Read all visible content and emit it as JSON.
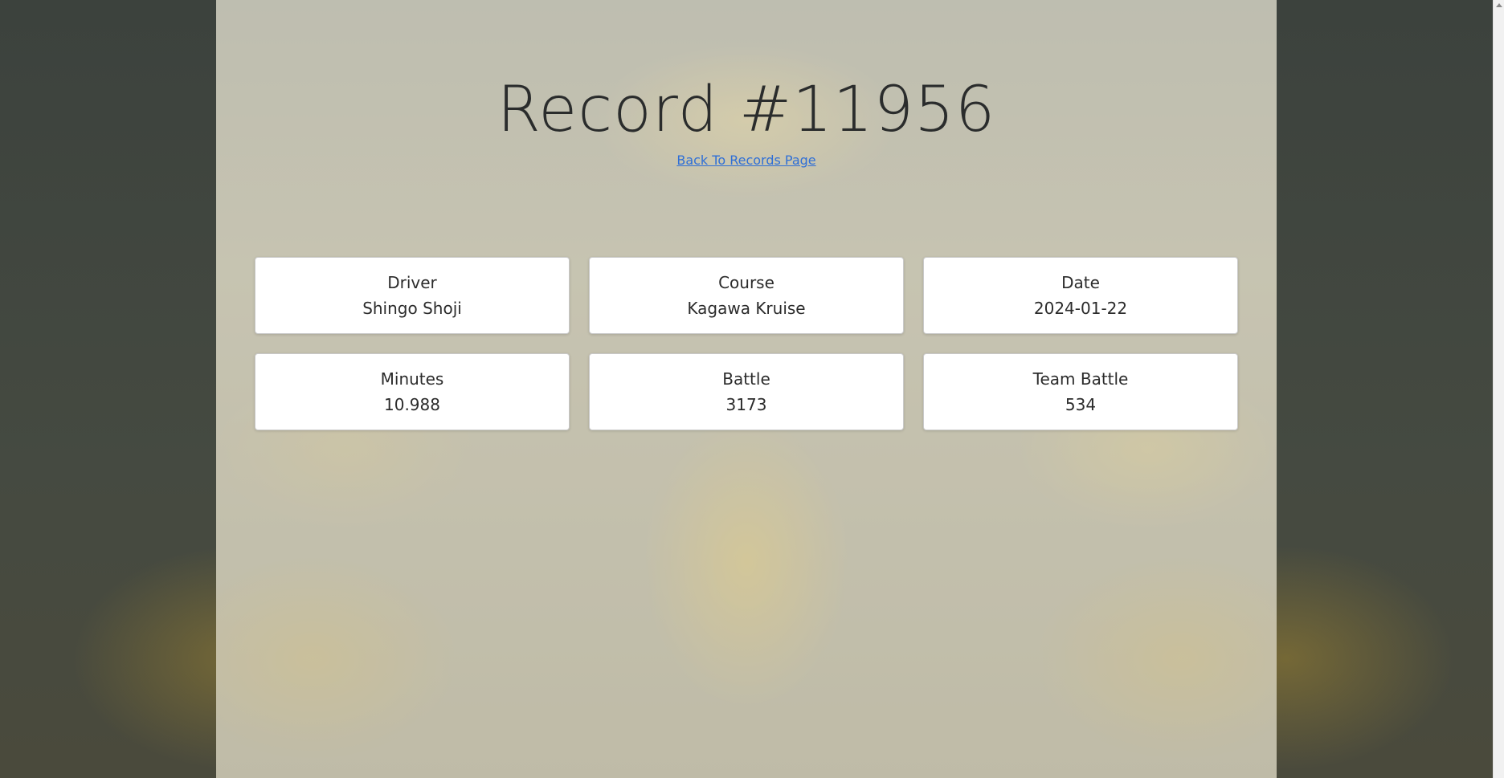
{
  "page": {
    "title": "Record #11956",
    "back_link": "Back To Records Page"
  },
  "fields": [
    {
      "label": "Driver",
      "value": "Shingo Shoji"
    },
    {
      "label": "Course",
      "value": "Kagawa Kruise"
    },
    {
      "label": "Date",
      "value": "2024-01-22"
    },
    {
      "label": "Minutes",
      "value": "10.988"
    },
    {
      "label": "Battle",
      "value": "3173"
    },
    {
      "label": "Team Battle",
      "value": "534"
    }
  ],
  "colors": {
    "link": "#2f6fd6",
    "card_background": "#ffffff",
    "title_text": "#2a2c2c"
  },
  "background": {
    "icons": [
      "trophy-icon",
      "checkered-flag-icon",
      "speedometer-icon",
      "race-car-icon"
    ]
  }
}
